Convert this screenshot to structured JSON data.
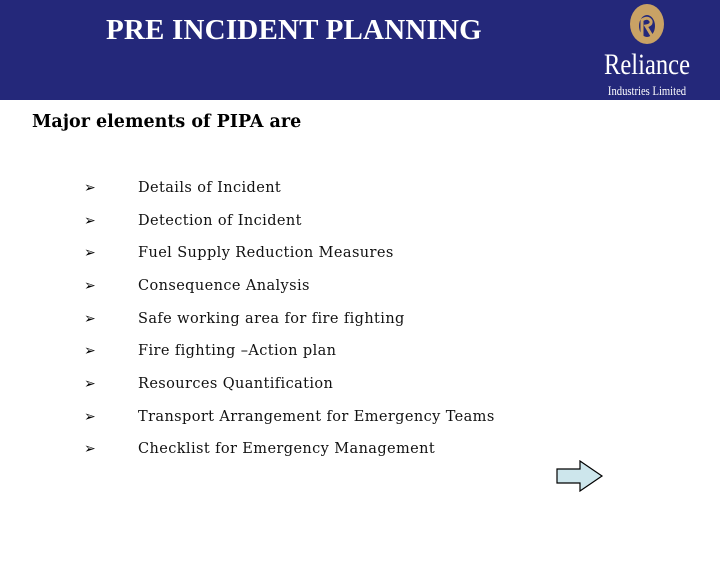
{
  "header": {
    "title": "PRE INCIDENT PLANNING",
    "background_color": "#24287a",
    "logo": {
      "icon": "reliance-emblem-icon",
      "name": "Reliance",
      "subtitle": "Industries Limited",
      "emblem_color": "#c9a265"
    }
  },
  "subheading": "Major elements of PIPA are",
  "bullet_glyph": "➢",
  "items": [
    {
      "label": "Details of Incident"
    },
    {
      "label": "Detection of Incident"
    },
    {
      "label": "Fuel Supply Reduction Measures"
    },
    {
      "label": "Consequence Analysis"
    },
    {
      "label": "Safe working area for fire fighting"
    },
    {
      "label": "Fire fighting –Action plan"
    },
    {
      "label": "Resources Quantification"
    },
    {
      "label": "Transport Arrangement for Emergency Teams"
    },
    {
      "label": "Checklist for Emergency Management"
    }
  ],
  "navigation": {
    "next_icon": "right-arrow-icon",
    "arrow_fill": "#cde6ec"
  }
}
